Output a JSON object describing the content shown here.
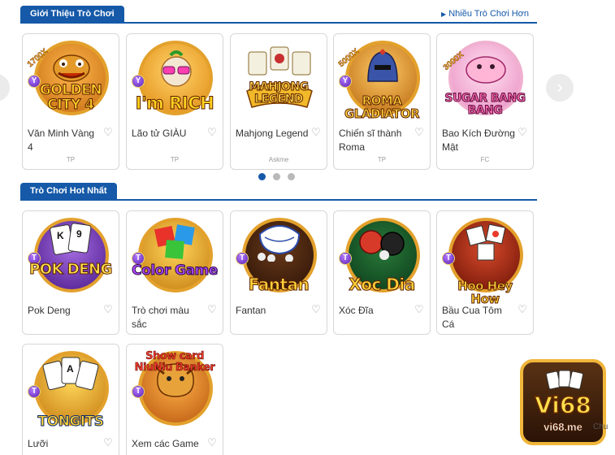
{
  "sections": {
    "intro": {
      "title": "Giới Thiệu Trò Chơi",
      "more_link": "Nhiều Trò Chơi Hơn"
    },
    "hot": {
      "title": "Trò Chơi Hot Nhất"
    }
  },
  "intro_games": [
    {
      "title": "Văn Minh Vàng 4",
      "provider": "TP",
      "logo": "GOLDEN CITY 4",
      "multiplier": "1700X",
      "badge": "Y"
    },
    {
      "title": "Lão tử GIÀU",
      "provider": "TP",
      "logo": "I'm RICH",
      "badge": "Y"
    },
    {
      "title": "Mahjong Legend",
      "provider": "Askme",
      "logo": "MAHJONG LEGEND"
    },
    {
      "title": "Chiến sĩ thành Roma",
      "provider": "TP",
      "logo": "ROMA GLADIATOR",
      "multiplier": "5000X",
      "badge": "Y"
    },
    {
      "title": "Bao Kích Đường Mật",
      "provider": "FC",
      "logo": "SUGAR BANG BANG",
      "multiplier": "3000X"
    }
  ],
  "hot_games": [
    {
      "title": "Pok Deng",
      "logo": "POK DENG",
      "badge": "T"
    },
    {
      "title": "Trò chơi màu sắc",
      "logo": "Color Game",
      "badge": "T"
    },
    {
      "title": "Fantan",
      "logo": "Fantan",
      "badge": "T"
    },
    {
      "title": "Xóc Đĩa",
      "logo": "Xoc Dia",
      "badge": "T"
    },
    {
      "title": "Bầu Cua Tôm Cá",
      "logo": "Hoo Hey How",
      "badge": "T"
    },
    {
      "title": "Lưỡi",
      "logo": "TONGITS",
      "badge": "T"
    },
    {
      "title": "Xem các Game",
      "logo": "Show card NiuNiu Banker",
      "badge": "T"
    }
  ],
  "carousel": {
    "page_count": 3,
    "active_index": 0
  },
  "promo": {
    "brand": "Vi68",
    "url": "vi68.me",
    "side_text": "Chu"
  },
  "colors": {
    "accent": "#1559a8",
    "dot_inactive": "#b9b9b9",
    "border": "#d7d7d7"
  },
  "icons": [
    "chevron-left-icon",
    "chevron-right-icon",
    "heart-icon",
    "triangle-right-icon"
  ]
}
